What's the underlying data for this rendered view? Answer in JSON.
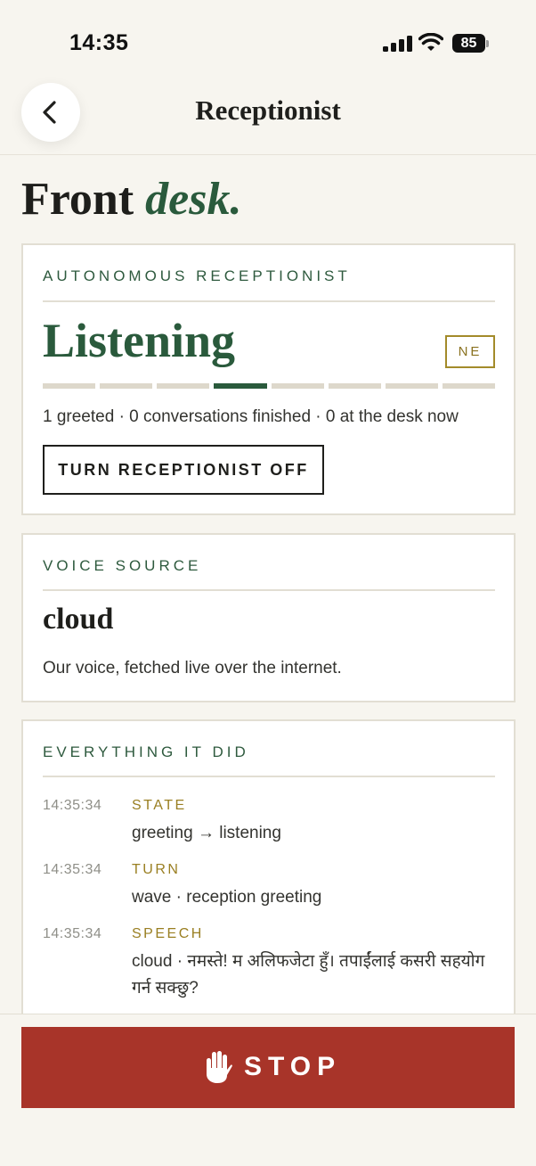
{
  "status_bar": {
    "time": "14:35",
    "battery": "85"
  },
  "header": {
    "title": "Receptionist"
  },
  "page": {
    "title_main": "Front",
    "title_accent": "desk."
  },
  "receptionist_card": {
    "label": "AUTONOMOUS RECEPTIONIST",
    "state": "Listening",
    "badge": "NE",
    "segments_total": 8,
    "active_segment": 4,
    "stats": "1 greeted · 0 conversations finished · 0 at the desk now",
    "toggle_label": "TURN RECEPTIONIST OFF"
  },
  "voice_card": {
    "label": "VOICE SOURCE",
    "value": "cloud",
    "description": "Our voice, fetched live over the internet."
  },
  "log_card": {
    "label": "EVERYTHING IT DID",
    "entries": [
      {
        "time": "14:35:34",
        "kind": "STATE",
        "text": "greeting → listening"
      },
      {
        "time": "14:35:34",
        "kind": "TURN",
        "text": "wave · reception greeting"
      },
      {
        "time": "14:35:34",
        "kind": "SPEECH",
        "text": "cloud · नमस्ते! म अलिफजेटा हुँ। तपाईंलाई कसरी सहयोग गर्न सक्छु?"
      }
    ]
  },
  "stop_button": {
    "label": "STOP",
    "icon": "hand-icon"
  },
  "colors": {
    "background": "#f7f5ef",
    "accent_green": "#2a5a3c",
    "accent_gold": "#9a7f22",
    "stop_red": "#a83429"
  }
}
